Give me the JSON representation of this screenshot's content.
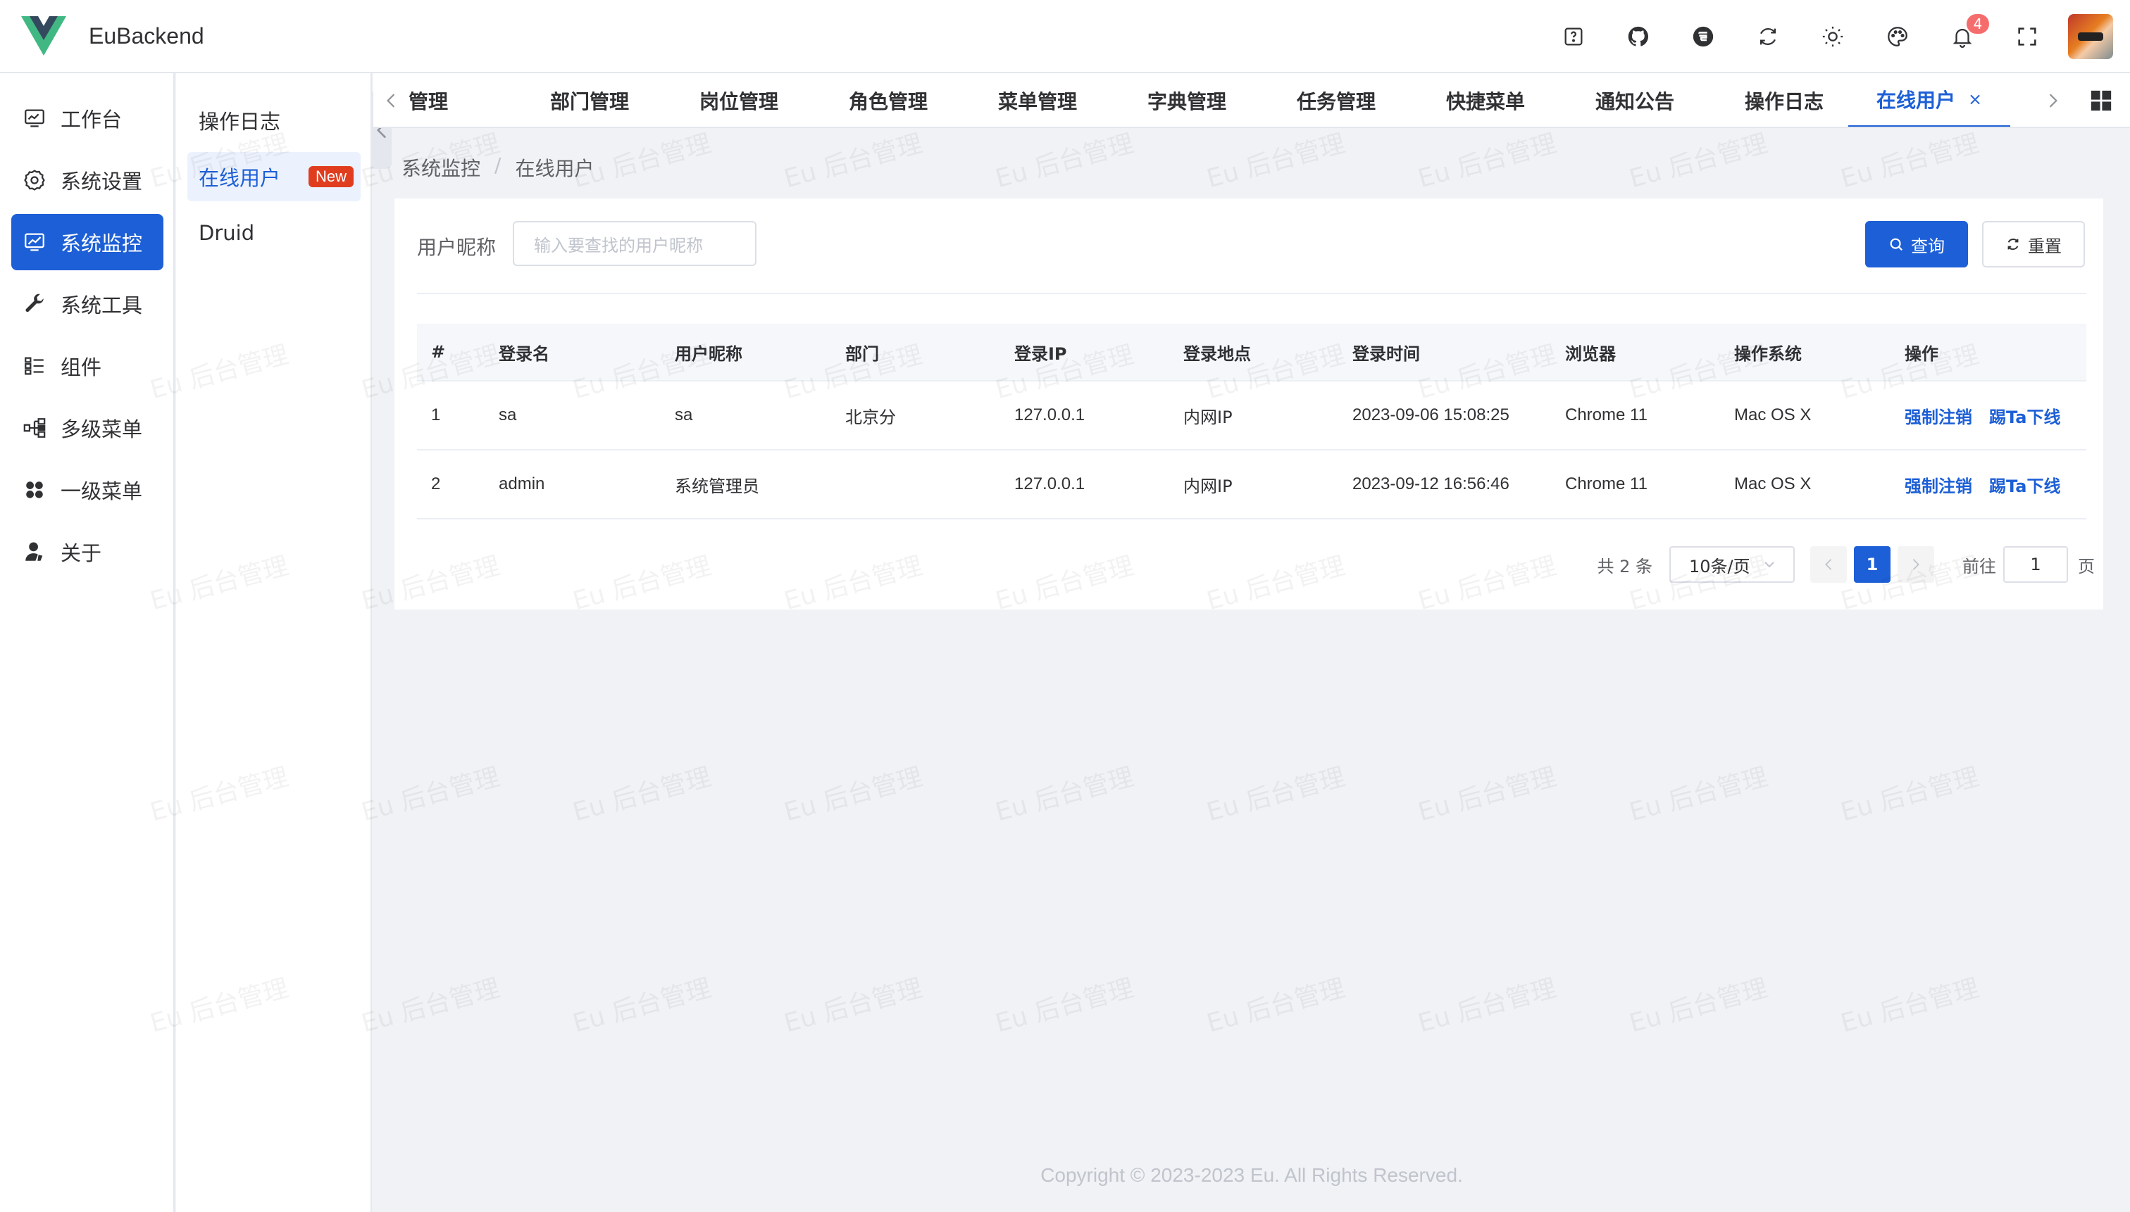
{
  "app": {
    "title": "EuBackend",
    "accent": "#1d5fd6"
  },
  "header": {
    "tools": [
      {
        "name": "help-icon"
      },
      {
        "name": "github-icon"
      },
      {
        "name": "gitee-icon"
      },
      {
        "name": "refresh-icon"
      },
      {
        "name": "theme-sun-icon"
      },
      {
        "name": "palette-icon"
      },
      {
        "name": "bell-icon",
        "badge": "4"
      },
      {
        "name": "fullscreen-icon"
      }
    ]
  },
  "sidebar": {
    "items": [
      {
        "label": "工作台",
        "icon": "monitor-icon"
      },
      {
        "label": "系统设置",
        "icon": "gear-icon"
      },
      {
        "label": "系统监控",
        "icon": "chart-monitor-icon",
        "active": true
      },
      {
        "label": "系统工具",
        "icon": "wrench-icon"
      },
      {
        "label": "组件",
        "icon": "list-grid-icon"
      },
      {
        "label": "多级菜单",
        "icon": "tree-icon"
      },
      {
        "label": "一级菜单",
        "icon": "clover-icon"
      },
      {
        "label": "关于",
        "icon": "user-icon"
      }
    ]
  },
  "submenu": {
    "items": [
      {
        "label": "操作日志"
      },
      {
        "label": "在线用户",
        "tag": "New",
        "active": true
      },
      {
        "label": "Druid"
      }
    ]
  },
  "tabs": [
    {
      "label": "管理"
    },
    {
      "label": "部门管理"
    },
    {
      "label": "岗位管理"
    },
    {
      "label": "角色管理"
    },
    {
      "label": "菜单管理"
    },
    {
      "label": "字典管理"
    },
    {
      "label": "任务管理"
    },
    {
      "label": "快捷菜单"
    },
    {
      "label": "通知公告"
    },
    {
      "label": "操作日志"
    },
    {
      "label": "在线用户",
      "active": true,
      "close": "×"
    }
  ],
  "breadcrumb": {
    "parent": "系统监控",
    "sep": "/",
    "current": "在线用户"
  },
  "search": {
    "label": "用户昵称",
    "placeholder": "输入要查找的用户昵称",
    "query_label": "查询",
    "reset_label": "重置"
  },
  "table": {
    "columns": [
      "#",
      "登录名",
      "用户昵称",
      "部门",
      "登录IP",
      "登录地点",
      "登录时间",
      "浏览器",
      "操作系统",
      "操作"
    ],
    "rows": [
      {
        "no": "1",
        "login": "sa",
        "nick": "sa",
        "dept": "北京分",
        "ip": "127.0.0.1",
        "loc": "内网IP",
        "time": "2023-09-06 15:08:25",
        "browser": "Chrome 11",
        "os": "Mac OS X",
        "act1": "强制注销",
        "act2": "踢Ta下线"
      },
      {
        "no": "2",
        "login": "admin",
        "nick": "系统管理员",
        "dept": "",
        "ip": "127.0.0.1",
        "loc": "内网IP",
        "time": "2023-09-12 16:56:46",
        "browser": "Chrome 11",
        "os": "Mac OS X",
        "act1": "强制注销",
        "act2": "踢Ta下线"
      }
    ]
  },
  "pagination": {
    "total": "共 2 条",
    "page_size": "10条/页",
    "current": "1",
    "goto_label": "前往",
    "goto_value": "1",
    "page_suffix": "页"
  },
  "footer": {
    "copyright": "Copyright © 2023-2023 Eu. All Rights Reserved."
  },
  "watermark": "Eu 后台管理"
}
